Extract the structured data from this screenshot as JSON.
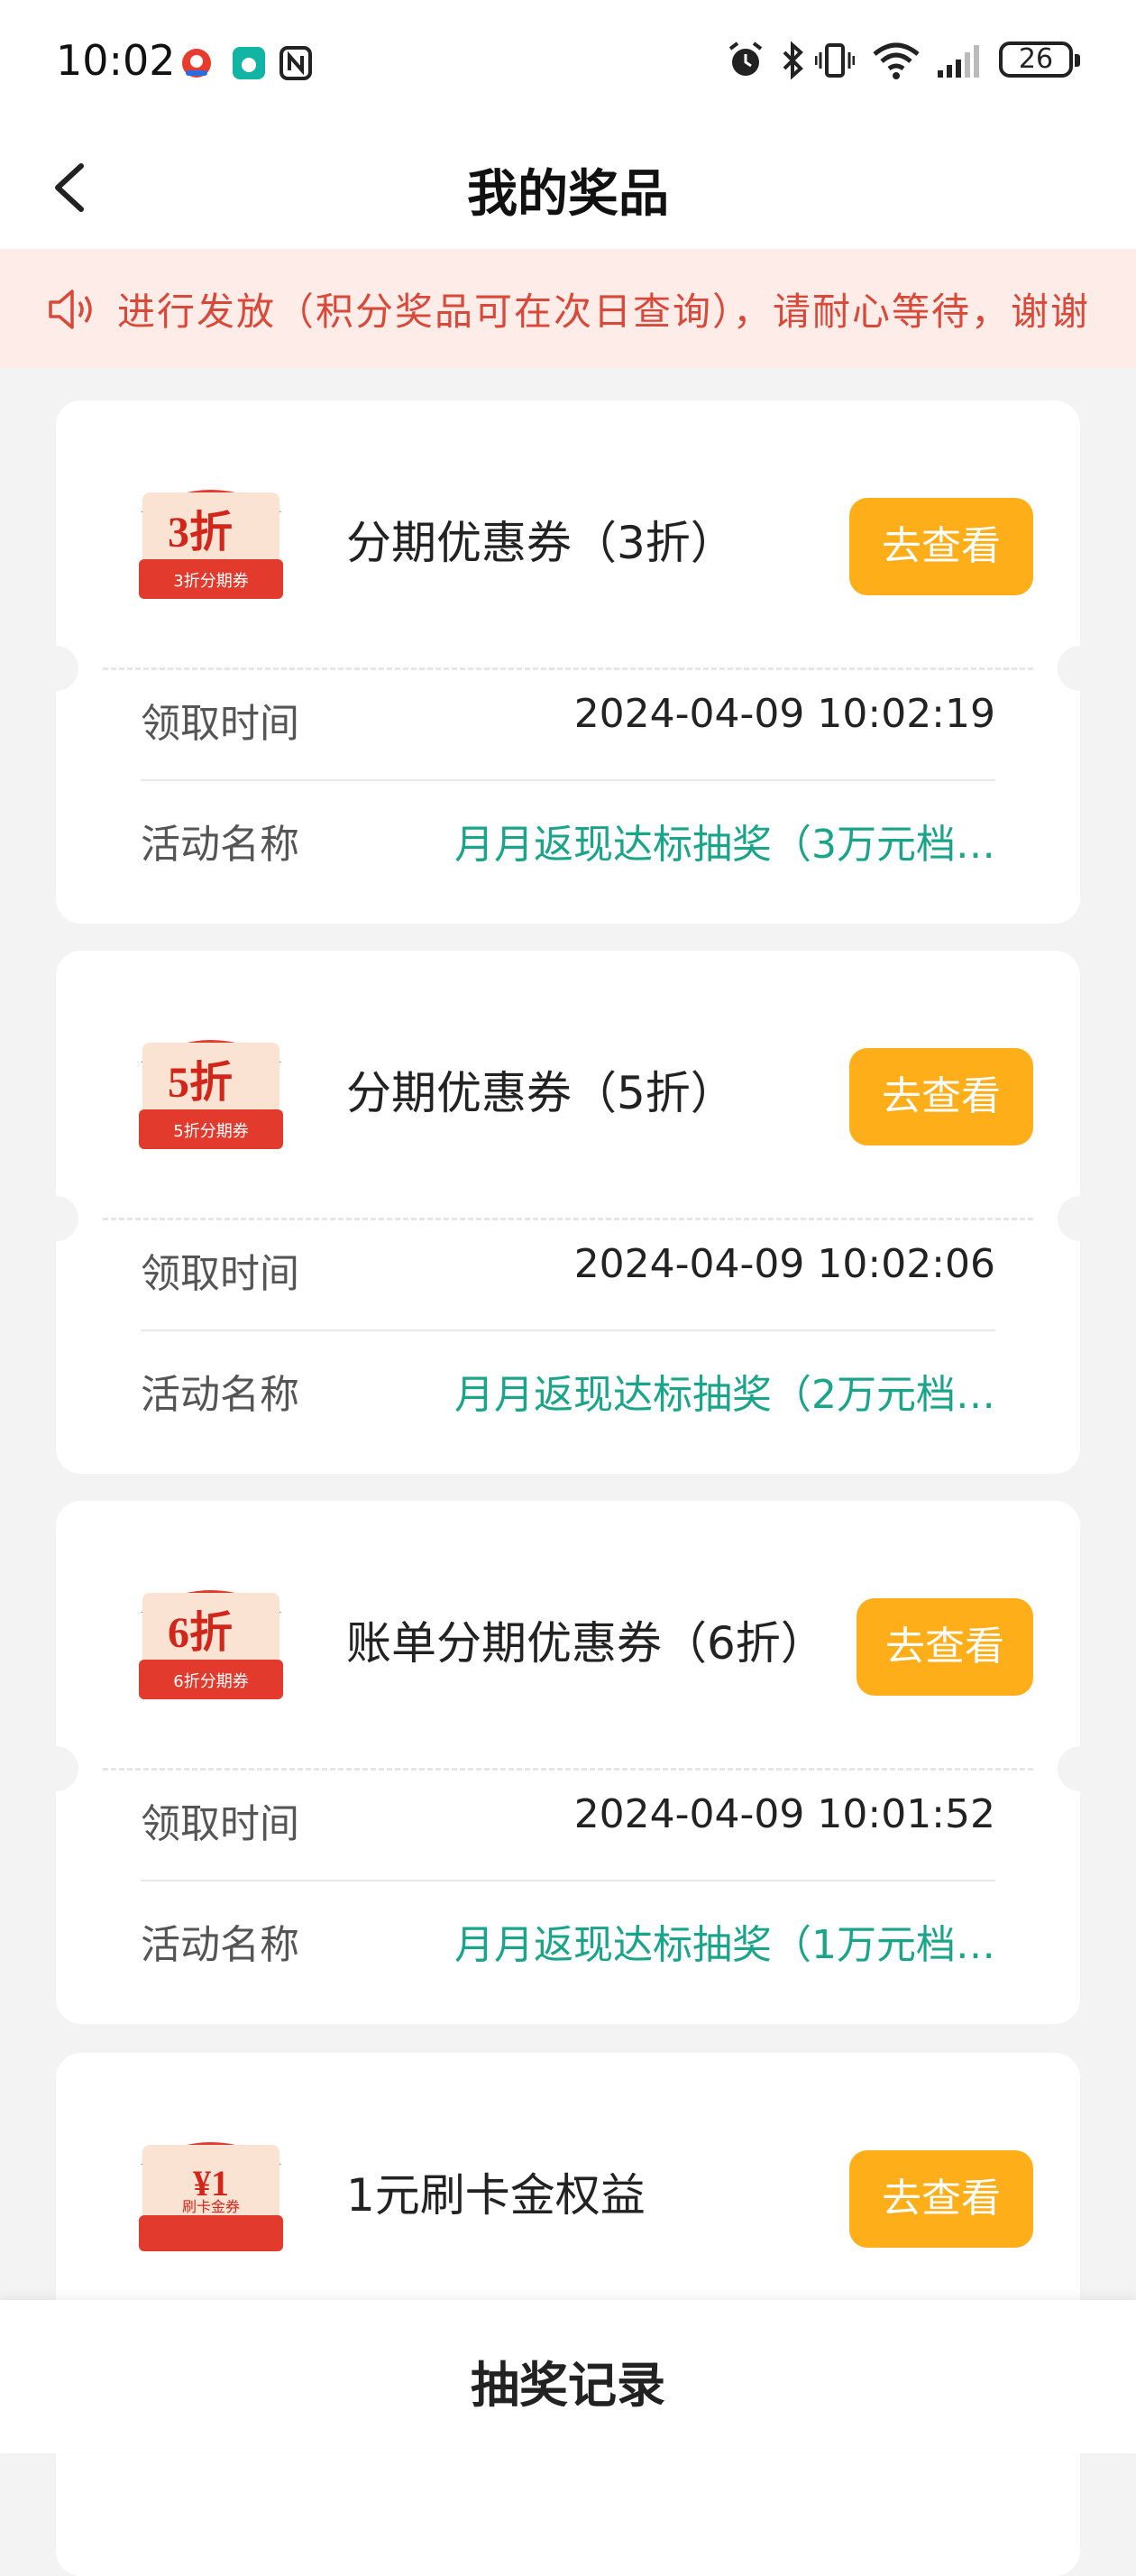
{
  "status_bar": {
    "time": "10:02",
    "battery": "26",
    "icons": [
      "alarm-icon",
      "bluetooth-icon",
      "vibrate-icon",
      "wifi-icon",
      "signal-icon",
      "battery-icon"
    ]
  },
  "header": {
    "title": "我的奖品",
    "back_icon": "chevron-left-icon"
  },
  "notice": {
    "icon": "speaker-icon",
    "text": "进行发放（积分奖品可在次日查询），请耐心等待，谢谢"
  },
  "labels": {
    "time": "领取时间",
    "activity": "活动名称",
    "view": "去查看"
  },
  "prizes": [
    {
      "title": "分期优惠券（3折）",
      "coupon_main": "3折",
      "coupon_sub": "3折分期券",
      "time": "2024-04-09 10:02:19",
      "activity": "月月返现达标抽奖（3万元档…"
    },
    {
      "title": "分期优惠券（5折）",
      "coupon_main": "5折",
      "coupon_sub": "5折分期券",
      "time": "2024-04-09 10:02:06",
      "activity": "月月返现达标抽奖（2万元档…"
    },
    {
      "title": "账单分期优惠券（6折）",
      "coupon_main": "6折",
      "coupon_sub": "6折分期券",
      "time": "2024-04-09 10:01:52",
      "activity": "月月返现达标抽奖（1万元档…"
    },
    {
      "title": "1元刷卡金权益",
      "coupon_main": "¥1",
      "coupon_sub": "刷卡金券",
      "time": "",
      "activity": ""
    }
  ],
  "bottom": {
    "label": "抽奖记录"
  },
  "colors": {
    "accent_orange": "#fdae19",
    "notice_red": "#d9493a",
    "activity_green": "#1aa48a",
    "coupon_red": "#e23a2c"
  }
}
